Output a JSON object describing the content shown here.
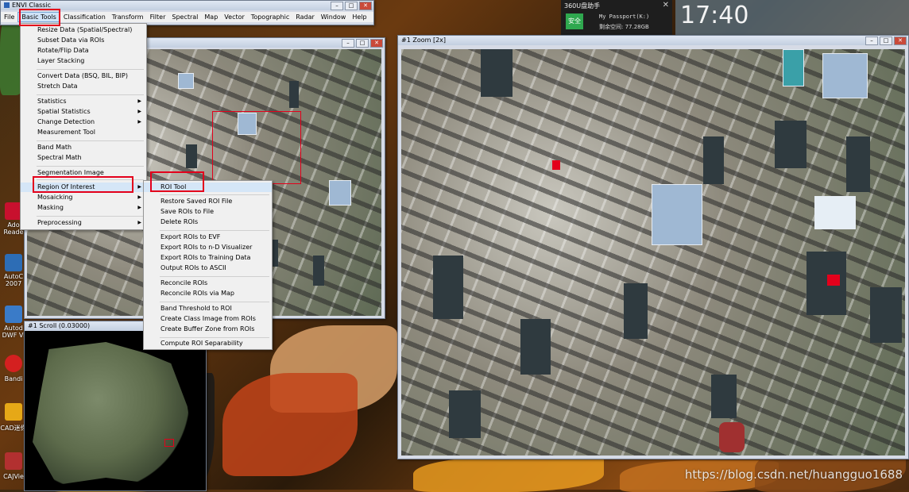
{
  "envi_window": {
    "title": "ENVI Classic",
    "menus": [
      "File",
      "Basic Tools",
      "Classification",
      "Transform",
      "Filter",
      "Spectral",
      "Map",
      "Vector",
      "Topographic",
      "Radar",
      "Window",
      "Help"
    ]
  },
  "basic_tools_menu": [
    {
      "label": "Resize Data (Spatial/Spectral)",
      "submenu": false
    },
    {
      "label": "Subset Data via ROIs",
      "submenu": false
    },
    {
      "label": "Rotate/Flip Data",
      "submenu": false
    },
    {
      "label": "Layer Stacking",
      "submenu": false
    },
    {
      "label": "Convert Data (BSQ, BIL, BIP)",
      "submenu": false
    },
    {
      "label": "Stretch Data",
      "submenu": false
    },
    {
      "label": "Statistics",
      "submenu": true
    },
    {
      "label": "Spatial Statistics",
      "submenu": true
    },
    {
      "label": "Change Detection",
      "submenu": true
    },
    {
      "label": "Measurement Tool",
      "submenu": false
    },
    {
      "label": "Band Math",
      "submenu": false
    },
    {
      "label": "Spectral Math",
      "submenu": false
    },
    {
      "label": "Segmentation Image",
      "submenu": false
    },
    {
      "label": "Region Of Interest",
      "submenu": true
    },
    {
      "label": "Mosaicking",
      "submenu": true
    },
    {
      "label": "Masking",
      "submenu": true
    },
    {
      "label": "Preprocessing",
      "submenu": true
    }
  ],
  "roi_submenu": [
    "ROI Tool",
    "Restore Saved ROI File",
    "Save ROIs to File",
    "Delete ROIs",
    "Export ROIs to EVF",
    "Export ROIs to n-D Visualizer",
    "Export ROIs to Training Data",
    "Output ROIs to ASCII",
    "Reconcile ROIs",
    "Reconcile ROIs via Map",
    "Band Threshold to ROI",
    "Create Class Image from ROIs",
    "Create Buffer Zone from ROIs",
    "Compute ROI Separability"
  ],
  "zoom_window": {
    "title": "#1 Zoom [2x]"
  },
  "scroll_window": {
    "title": "#1 Scroll (0.03000)"
  },
  "usb_popup": {
    "title": "360U盘助手",
    "badge": "安全",
    "device": "My Passport(K:)",
    "free": "剩余空间: 77.28GB"
  },
  "desktop_icons": [
    {
      "label": "Ado Reade",
      "color": "#c8102e"
    },
    {
      "label": "AutoC 2007",
      "color": "#2d6db5"
    },
    {
      "label": "Autod DWF Vi",
      "color": "#3a7bc8"
    },
    {
      "label": "Bandi",
      "color": "#d42020"
    },
    {
      "label": "CAD迷你",
      "color": "#e6a817"
    },
    {
      "label": "CAJVie",
      "color": "#b23030"
    }
  ],
  "clock_partial": "17:40",
  "watermark": "https://blog.csdn.net/huangguo1688",
  "colors": {
    "highlight_box": "#e3001b",
    "menu_bg": "#f0f0f0",
    "title_bg": "#c3cfe0"
  }
}
